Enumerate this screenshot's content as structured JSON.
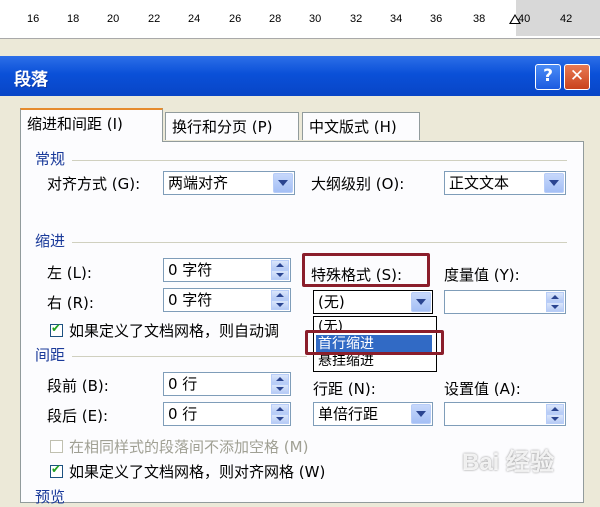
{
  "ruler": {
    "numbers": [
      "16",
      "18",
      "20",
      "22",
      "24",
      "26",
      "28",
      "30",
      "32",
      "34",
      "36",
      "38",
      "40",
      "42"
    ]
  },
  "dialog": {
    "title": "段落",
    "help": "?",
    "close": "✕"
  },
  "tabs": [
    {
      "label": "缩进和间距 (I)"
    },
    {
      "label": "换行和分页 (P)"
    },
    {
      "label": "中文版式 (H)"
    }
  ],
  "general": {
    "heading": "常规",
    "alignment_label": "对齐方式 (G):",
    "alignment_value": "两端对齐",
    "outline_label": "大纲级别 (O):",
    "outline_value": "正文文本"
  },
  "indent": {
    "heading": "缩进",
    "left_label": "左 (L):",
    "left_value": "0 字符",
    "right_label": "右 (R):",
    "right_value": "0 字符",
    "special_label": "特殊格式 (S):",
    "special_value": "(无)",
    "by_label": "度量值 (Y):",
    "by_value": "",
    "grid_checkbox_label": "如果定义了文档网格，则自动调",
    "dropdown_options": [
      "(无)",
      "首行缩进",
      "悬挂缩进"
    ]
  },
  "spacing": {
    "heading": "间距",
    "before_label": "段前 (B):",
    "before_value": "0 行",
    "after_label": "段后 (E):",
    "after_value": "0 行",
    "line_label": "行距 (N):",
    "line_value": "单倍行距",
    "at_label": "设置值 (A):",
    "at_value": "",
    "no_space_label": "在相同样式的段落间不添加空格 (M)",
    "snap_grid_label": "如果定义了文档网格，则对齐网格 (W)"
  },
  "preview": {
    "heading": "预览"
  },
  "watermark": "Bai 经验"
}
